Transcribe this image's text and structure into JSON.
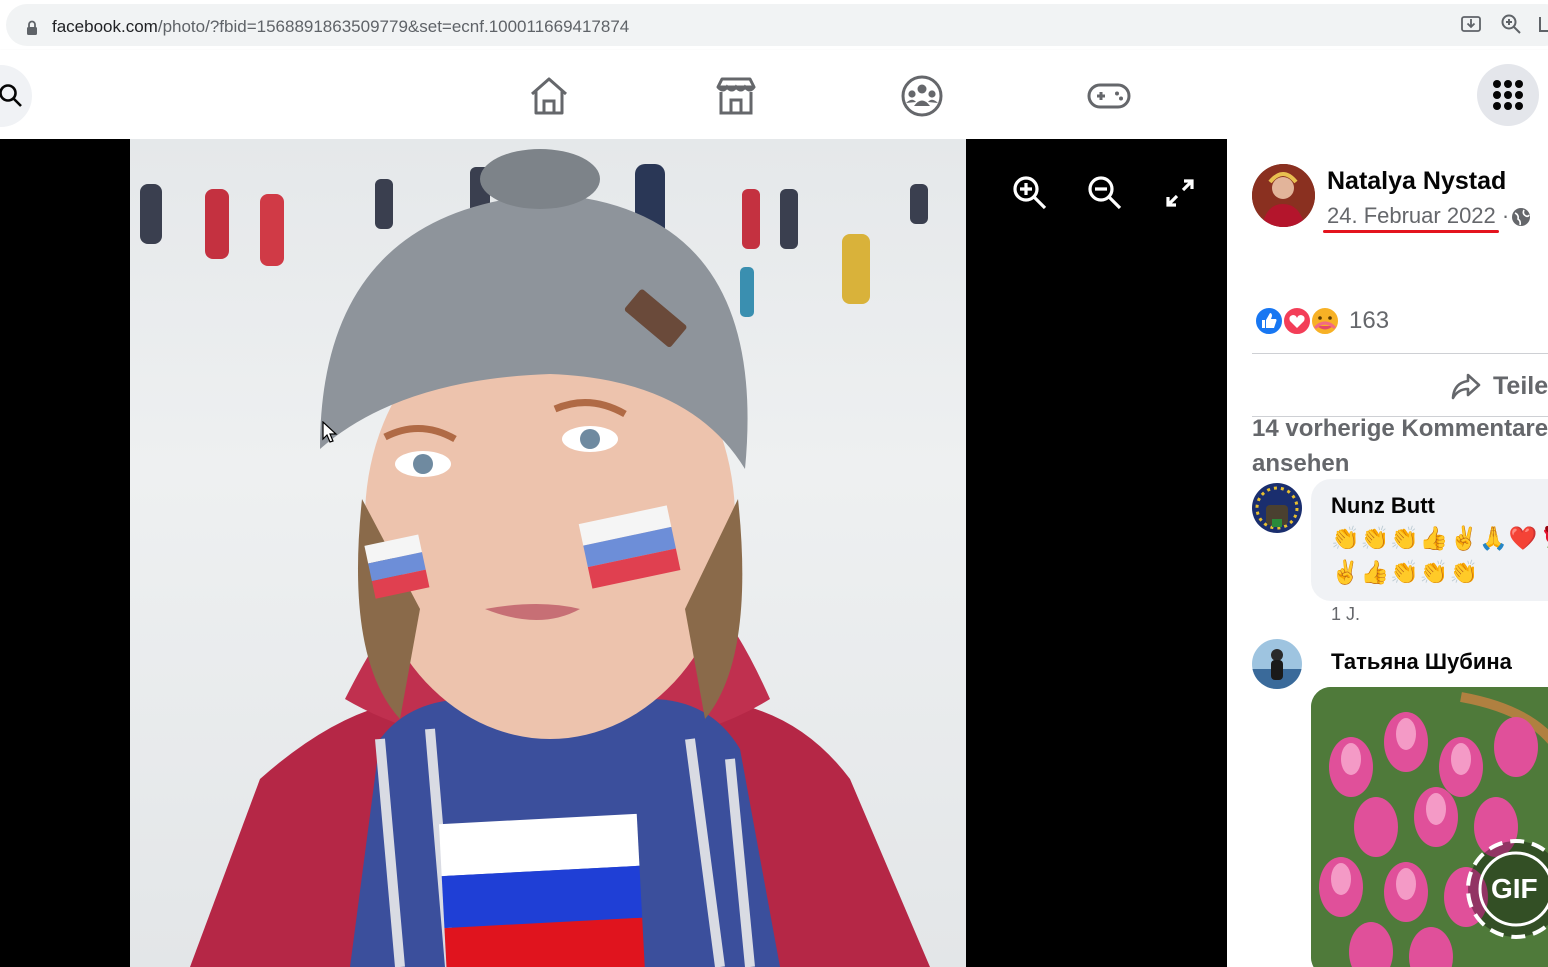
{
  "browser": {
    "url_domain": "facebook.com",
    "url_path": "/photo/?fbid=1568891863509779&set=ecnf.100011669417874"
  },
  "topbar": {
    "nav": [
      {
        "name": "home-icon"
      },
      {
        "name": "marketplace-icon"
      },
      {
        "name": "groups-icon"
      },
      {
        "name": "gaming-icon"
      }
    ],
    "menu_icon": "grid-menu-icon"
  },
  "viewer": {
    "controls": [
      "zoom-in-icon",
      "zoom-out-icon",
      "fullscreen-icon"
    ]
  },
  "post": {
    "author": "Natalya Nystad",
    "date": "24. Februar 2022",
    "date_separator": "·",
    "privacy_icon": "globe-icon",
    "reaction_count": "163",
    "reactions": [
      "like",
      "love",
      "care"
    ],
    "share_label": "Teilen"
  },
  "comments": {
    "previous_label": "14 vorherige Kommentare ansehen",
    "items": [
      {
        "author": "Nunz Butt",
        "text_line1": "👏👏👏👍✌🙏❤️🌹",
        "text_line2": "✌👍👏👏👏",
        "time": "1 J."
      },
      {
        "author": "Татьяна Шубина",
        "gif_label": "GIF"
      }
    ]
  },
  "colors": {
    "accent_underline": "#e4141e",
    "secondary_text": "#65676b",
    "viewer_bg": "#000000"
  }
}
